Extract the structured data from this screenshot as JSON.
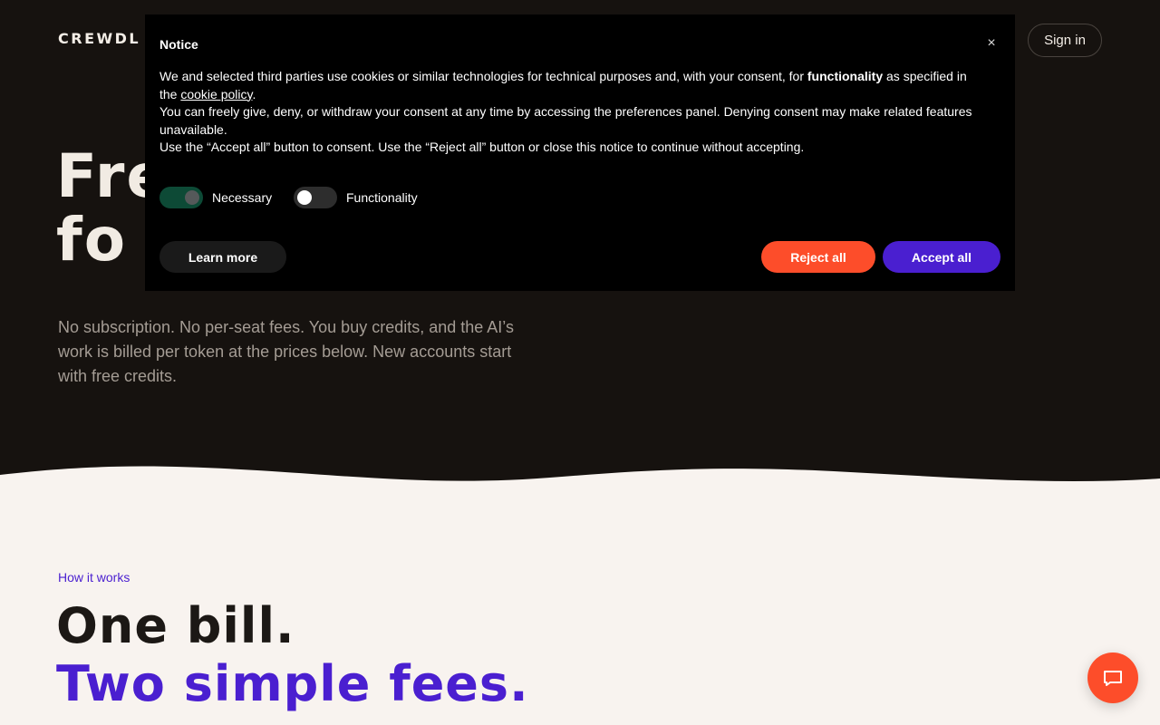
{
  "header": {
    "logo": "CREWDL",
    "sign_in": "Sign in"
  },
  "hero": {
    "title_line1": "Fre",
    "title_line2": "fo",
    "subtitle": "No subscription. No per-seat fees. You buy credits, and the AI’s work is billed per token at the prices below. New accounts start with free credits."
  },
  "how": {
    "label": "How it works",
    "heading_line1": "One bill.",
    "heading_line2": "Two simple fees."
  },
  "cookie_notice": {
    "title": "Notice",
    "close": "×",
    "p1_before": "We and selected third parties use cookies or similar technologies for technical purposes and, with your consent, for ",
    "p1_bold": "functionality",
    "p1_mid": " as specified in the ",
    "p1_link": "cookie policy",
    "p1_after": ".",
    "p2": "You can freely give, deny, or withdraw your consent at any time by accessing the preferences panel. Denying consent may make related features unavailable.",
    "p3": "Use the “Accept all” button to consent. Use the “Reject all” button or close this notice to continue without accepting.",
    "toggles": [
      {
        "label": "Necessary",
        "on": true
      },
      {
        "label": "Functionality",
        "on": false
      }
    ],
    "learn_more": "Learn more",
    "reject_all": "Reject all",
    "accept_all": "Accept all"
  },
  "colors": {
    "hero_bg": "#16120f",
    "page_bg": "#f8f3ef",
    "accent_purple": "#4a1fd0",
    "accent_orange": "#fd4d2a"
  },
  "icons": {
    "chat": "chat-bubble-icon",
    "close": "close-icon"
  }
}
